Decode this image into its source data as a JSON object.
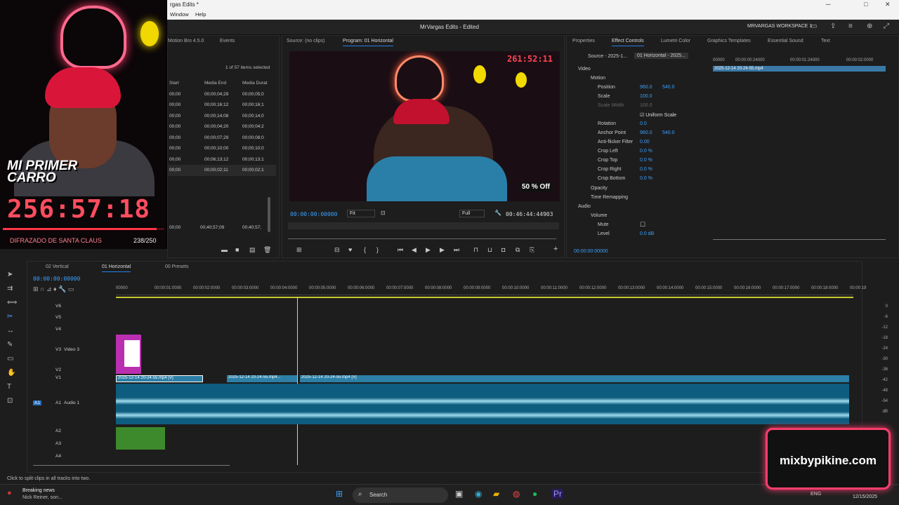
{
  "window": {
    "title_partial": "rgas Edits *"
  },
  "menu": {
    "items": [
      "Window",
      "Help"
    ]
  },
  "app": {
    "title": "MrVargas Edits - Edited",
    "workspace": "MRVARGAS WORKSPACE 1"
  },
  "overlay": {
    "badge": "MI PRIMER CARRO",
    "timer": "256:57:18",
    "label": "DIFRAZADO DE SANTA CLAUS",
    "count": "238/250",
    "progress": 0.952
  },
  "project": {
    "tabs": [
      "Motion Bro 4.5.0",
      "Events"
    ],
    "selection": "1 of 57 items selected",
    "columns": [
      "Start",
      "Media End",
      "Media Durat"
    ],
    "rows": [
      [
        "00;00",
        "00;00;04;29",
        "00;00;05;0"
      ],
      [
        "00;00",
        "00;00;16;12",
        "00;00;16;1"
      ],
      [
        "00;00",
        "00;00;14;08",
        "00;00;14;0"
      ],
      [
        "00;00",
        "00;00;04;20",
        "00;00;04;2"
      ],
      [
        "00;00",
        "00;00;07;29",
        "00;00;08;0"
      ],
      [
        "00;00",
        "00;00;10;00",
        "00;00;10;0"
      ],
      [
        "00;00",
        "00;06;13;12",
        "00;00;13;1"
      ],
      [
        "00;00",
        "00;00;02;11",
        "00;00;02;1"
      ]
    ],
    "last_row": [
      "00;00",
      "00;40;57;09",
      "00;40;57;"
    ]
  },
  "program": {
    "source_tab": "Source: (no clips)",
    "program_tab": "Program: 01 Horizontal",
    "timecode": "00:00:00:00000",
    "fit": "Fit",
    "quality": "Full",
    "duration": "00:46:44:44903",
    "frame_clock": "261:52:11",
    "frame_offer": "50 % Off"
  },
  "effects": {
    "tabs": [
      "Properties",
      "Effect Controls",
      "Lumetri Color",
      "Graphics Templates",
      "Essential Sound",
      "Text"
    ],
    "source": "Source - 2025-1...",
    "sequence": "01 Horizontal - 2025...",
    "ruler": [
      "00000",
      "00:00:00:24000",
      "00:00:01:24000",
      "00:00:02:0000"
    ],
    "clip_name": "2025-12-14 20-24-55.mp4",
    "video_label": "Video",
    "motion": "Motion",
    "position": {
      "label": "Position",
      "x": "960.0",
      "y": "540.0"
    },
    "scale": {
      "label": "Scale",
      "value": "100.0"
    },
    "scale_width": {
      "label": "Scale Width",
      "value": "100.0"
    },
    "uniform": "Uniform Scale",
    "rotation": {
      "label": "Rotation",
      "value": "0.0"
    },
    "anchor": {
      "label": "Anchor Point",
      "x": "960.0",
      "y": "540.0"
    },
    "antiflicker": {
      "label": "Anti-flicker Filter",
      "value": "0.00"
    },
    "crop_left": {
      "label": "Crop Left",
      "value": "0.0 %"
    },
    "crop_top": {
      "label": "Crop Top",
      "value": "0.0 %"
    },
    "crop_right": {
      "label": "Crop Right",
      "value": "0.0 %"
    },
    "crop_bottom": {
      "label": "Crop Bottom",
      "value": "0.0 %"
    },
    "opacity": "Opacity",
    "time_remap": "Time Remapping",
    "audio_label": "Audio",
    "volume": "Volume",
    "mute": "Mute",
    "level": {
      "label": "Level",
      "value": "0.0 dB"
    },
    "bottom_tc": "00:00:00:00000"
  },
  "timeline": {
    "tabs": [
      "02 Vertical",
      "01 Horizontal",
      "00 Presets"
    ],
    "timecode": "00:00:00:00000",
    "ruler": [
      "00000",
      "00:00:01:0000",
      "00:00:02:0000",
      "00:00:03:0000",
      "00:00:04:0000",
      "00:00:05:0000",
      "00:00:06:0000",
      "00:00:07:0000",
      "00:00:08:0000",
      "00:00:09:0000",
      "00:00:10:0000",
      "00:00:11:0000",
      "00:00:12:0000",
      "00:00:13:0000",
      "00:00:14:0000",
      "00:00:15:0000",
      "00:00:16:0000",
      "00:00:17:0000",
      "00:00:18:0000",
      "00:00:19"
    ],
    "video_tracks": [
      "V6",
      "V5",
      "V4",
      "V3",
      "V2",
      "V1"
    ],
    "v3_name": "Video 3",
    "audio_tracks": [
      "A1",
      "A2",
      "A3",
      "A4"
    ],
    "a1_name": "Audio 1",
    "clips": [
      "2025-12-14 20-24-55.mp4 [V]",
      "2025-12-14 20-24-55.mp4...",
      "2025-12-14 20-24-55.mp4 [V]"
    ],
    "meter": [
      "0",
      "-6",
      "-12",
      "-18",
      "-24",
      "-30",
      "-36",
      "-42",
      "-48",
      "-54",
      "dB"
    ]
  },
  "status": {
    "text": "Click to split clips in all tracks into two."
  },
  "taskbar": {
    "news_title": "Breaking news",
    "news_sub": "Nick Reiner, son...",
    "search": "Search",
    "lang": "ENG",
    "date": "12/15/2025"
  },
  "watermark": {
    "text": "mixbypikine.com"
  },
  "colors": {
    "accent": "#2680eb",
    "clip_blue": "#2c7fa6",
    "audio_teal": "#0e5d7e"
  }
}
